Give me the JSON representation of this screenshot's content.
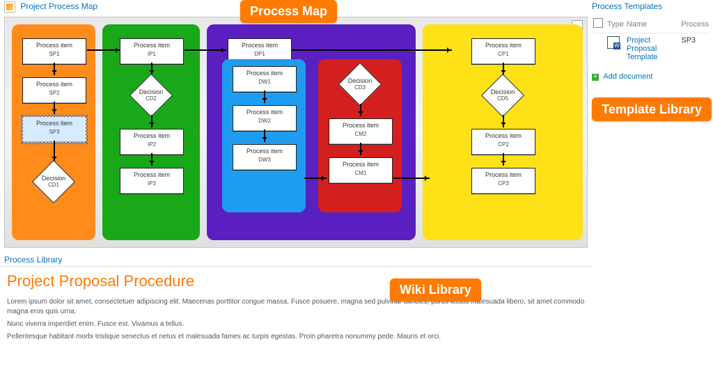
{
  "header_main": "Project Process Map",
  "header_side": "Process Templates",
  "header_lib": "Process Library",
  "callouts": {
    "map": "Process Map",
    "wiki": "Wiki Library",
    "tmpl": "Template Library"
  },
  "diagram": {
    "lanes": {
      "orange": [
        {
          "label": "Process item",
          "code": "SP1"
        },
        {
          "label": "Process item",
          "code": "SP2"
        },
        {
          "label": "Process item",
          "code": "SP3",
          "selected": true
        },
        {
          "label": "Decision",
          "code": "CD1",
          "diamond": true
        }
      ],
      "green": [
        {
          "label": "Process item",
          "code": "IP1"
        },
        {
          "label": "Decision",
          "code": "CD2",
          "diamond": true
        },
        {
          "label": "Process item",
          "code": "IP2"
        },
        {
          "label": "Process item",
          "code": "IP3"
        }
      ],
      "purple_top": {
        "label": "Process item",
        "code": "DP1"
      },
      "blue": [
        {
          "label": "Process item",
          "code": "DW1"
        },
        {
          "label": "Process item",
          "code": "DW2"
        },
        {
          "label": "Process item",
          "code": "DW3"
        }
      ],
      "red": [
        {
          "label": "Decision",
          "code": "CD3",
          "diamond": true
        },
        {
          "label": "Process item",
          "code": "CM2"
        },
        {
          "label": "Process item",
          "code": "CM1"
        }
      ],
      "yellow": [
        {
          "label": "Process item",
          "code": "CP1"
        },
        {
          "label": "Decision",
          "code": "CD5",
          "diamond": true
        },
        {
          "label": "Process item",
          "code": "CP2"
        },
        {
          "label": "Process item",
          "code": "CP3"
        }
      ]
    }
  },
  "templates": {
    "cols": {
      "chk": "",
      "type": "Type",
      "name": "Name",
      "process": "Process"
    },
    "rows": [
      {
        "name": "Project Proposal Template",
        "process": "SP3"
      }
    ],
    "add": "Add document"
  },
  "library_doc": {
    "title": "Project Proposal Procedure",
    "p1": "Lorem ipsum dolor sit amet, consectetuer adipiscing elit. Maecenas porttitor congue massa. Fusce posuere, magna sed pulvinar ultricies, purus lectus malesuada libero, sit amet commodo magna eros quis urna.",
    "p2": "Nunc viverra imperdiet enim. Fusce est. Vivamus a tellus.",
    "p3": "Pellentesque habitant morbi tristique senectus et netus et malesuada fames ac turpis egestas. Proin pharetra nonummy pede. Mauris et orci."
  }
}
